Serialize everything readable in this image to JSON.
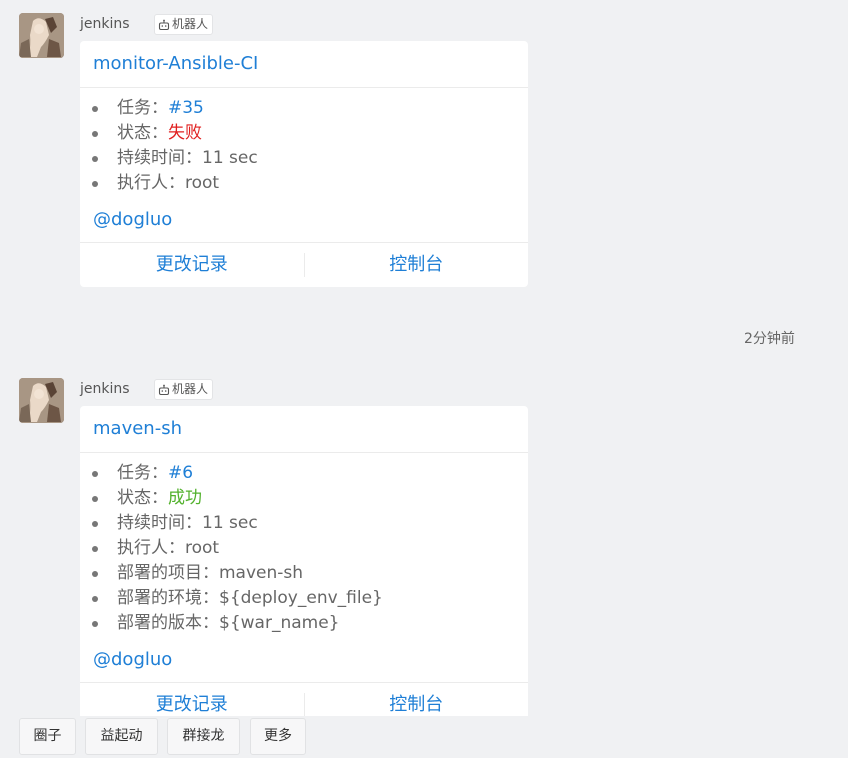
{
  "messages": [
    {
      "sender": "jenkins",
      "robot_tag": "机器人",
      "card": {
        "title": "monitor-Ansible-CI",
        "items": [
          {
            "label": "任务：",
            "value": "#35",
            "value_color": "blue"
          },
          {
            "label": "状态：",
            "value": "失败",
            "value_color": "red"
          },
          {
            "label": "持续时间：",
            "value": "11 sec",
            "value_color": "gray"
          },
          {
            "label": "执行人：",
            "value": "root",
            "value_color": "gray"
          }
        ],
        "mention": "@dogluo",
        "actions": [
          "更改记录",
          "控制台"
        ]
      }
    },
    {
      "sender": "jenkins",
      "robot_tag": "机器人",
      "card": {
        "title": "maven-sh",
        "items": [
          {
            "label": "任务：",
            "value": "#6",
            "value_color": "blue"
          },
          {
            "label": "状态：",
            "value": "成功",
            "value_color": "green"
          },
          {
            "label": "持续时间：",
            "value": "11 sec",
            "value_color": "gray"
          },
          {
            "label": "执行人：",
            "value": "root",
            "value_color": "gray"
          },
          {
            "label": "部署的项目：",
            "value": "maven-sh",
            "value_color": "gray"
          },
          {
            "label": "部署的环境：",
            "value": "${deploy_env_file}",
            "value_color": "gray"
          },
          {
            "label": "部署的版本：",
            "value": "${war_name}",
            "value_color": "gray"
          }
        ],
        "mention": "@dogluo",
        "actions": [
          "更改记录",
          "控制台"
        ]
      }
    }
  ],
  "time_divider": "2分钟前",
  "bottom_bar": {
    "chips": [
      "圈子",
      "益起动",
      "群接龙",
      "更多"
    ]
  },
  "colors": {
    "link_blue": "#1f7fd6",
    "fail_red": "#e02020",
    "success_green": "#52b12c",
    "background": "#f0f1f3"
  },
  "icons": {
    "avatar": "avatar-image",
    "robot": "robot-icon"
  }
}
